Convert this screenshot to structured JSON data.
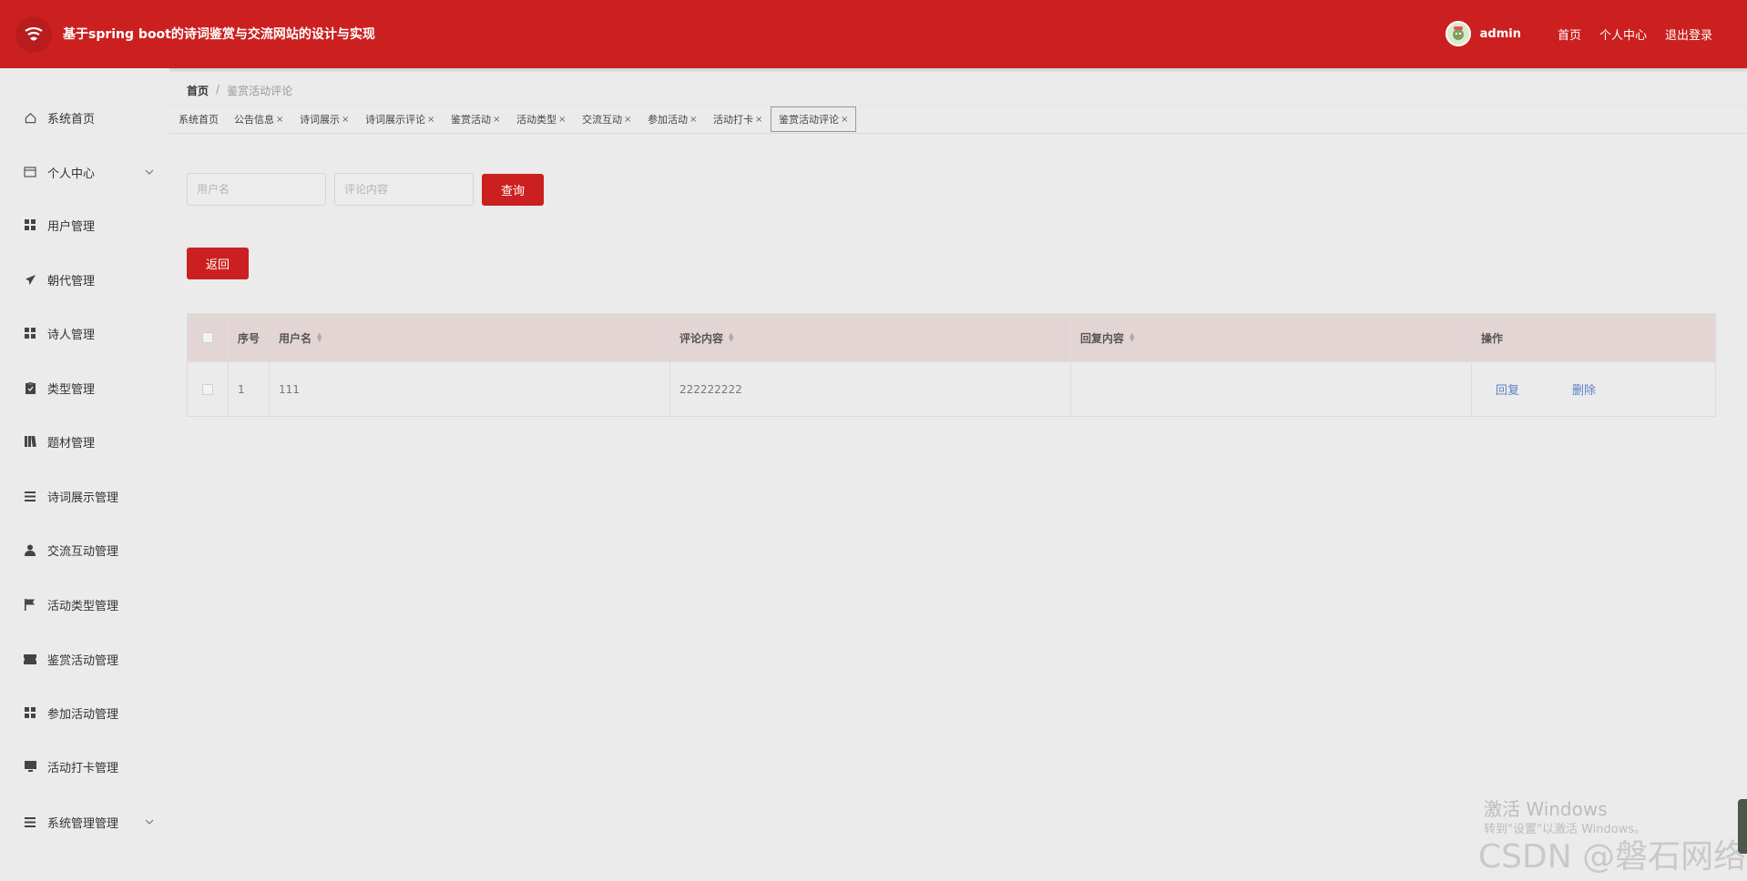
{
  "app": {
    "title": "基于spring boot的诗词鉴赏与交流网站的设计与实现"
  },
  "header": {
    "username": "admin",
    "links": [
      "首页",
      "个人中心",
      "退出登录"
    ]
  },
  "sidebar": {
    "items": [
      {
        "label": "系统首页",
        "icon": "home-icon"
      },
      {
        "label": "个人中心",
        "icon": "id-card-icon",
        "expandable": true
      },
      {
        "label": "用户管理",
        "icon": "grid-icon"
      },
      {
        "label": "朝代管理",
        "icon": "paper-plane-icon"
      },
      {
        "label": "诗人管理",
        "icon": "grid-icon"
      },
      {
        "label": "类型管理",
        "icon": "clipboard-icon"
      },
      {
        "label": "题材管理",
        "icon": "books-icon"
      },
      {
        "label": "诗词展示管理",
        "icon": "list-icon"
      },
      {
        "label": "交流互动管理",
        "icon": "user-icon"
      },
      {
        "label": "活动类型管理",
        "icon": "flag-icon"
      },
      {
        "label": "鉴赏活动管理",
        "icon": "ticket-icon"
      },
      {
        "label": "参加活动管理",
        "icon": "grid-icon"
      },
      {
        "label": "活动打卡管理",
        "icon": "monitor-icon"
      },
      {
        "label": "系统管理管理",
        "icon": "list-icon",
        "expandable": true
      }
    ]
  },
  "breadcrumb": {
    "home": "首页",
    "separator": "/",
    "current": "鉴赏活动评论"
  },
  "tabs": [
    {
      "label": "系统首页",
      "closable": false
    },
    {
      "label": "公告信息",
      "closable": true
    },
    {
      "label": "诗词展示",
      "closable": true
    },
    {
      "label": "诗词展示评论",
      "closable": true
    },
    {
      "label": "鉴赏活动",
      "closable": true
    },
    {
      "label": "活动类型",
      "closable": true
    },
    {
      "label": "交流互动",
      "closable": true
    },
    {
      "label": "参加活动",
      "closable": true
    },
    {
      "label": "活动打卡",
      "closable": true
    },
    {
      "label": "鉴赏活动评论",
      "closable": true,
      "active": true
    }
  ],
  "search": {
    "username_placeholder": "用户名",
    "content_placeholder": "评论内容",
    "query_label": "查询"
  },
  "back_label": "返回",
  "table": {
    "columns": [
      "序号",
      "用户名",
      "评论内容",
      "回复内容",
      "操作"
    ],
    "rows": [
      {
        "index": "1",
        "username": "111",
        "content": "222222222",
        "reply": "",
        "actions": [
          "回复",
          "删除"
        ]
      }
    ]
  },
  "watermark": {
    "activate_title": "激活 Windows",
    "activate_sub": "转到\"设置\"以激活 Windows。",
    "csdn": "CSDN @磐石网络"
  },
  "colors": {
    "brand_red": "#cc2020",
    "table_header_bg": "#e4d5d5",
    "link_blue": "#5b7fc9"
  }
}
